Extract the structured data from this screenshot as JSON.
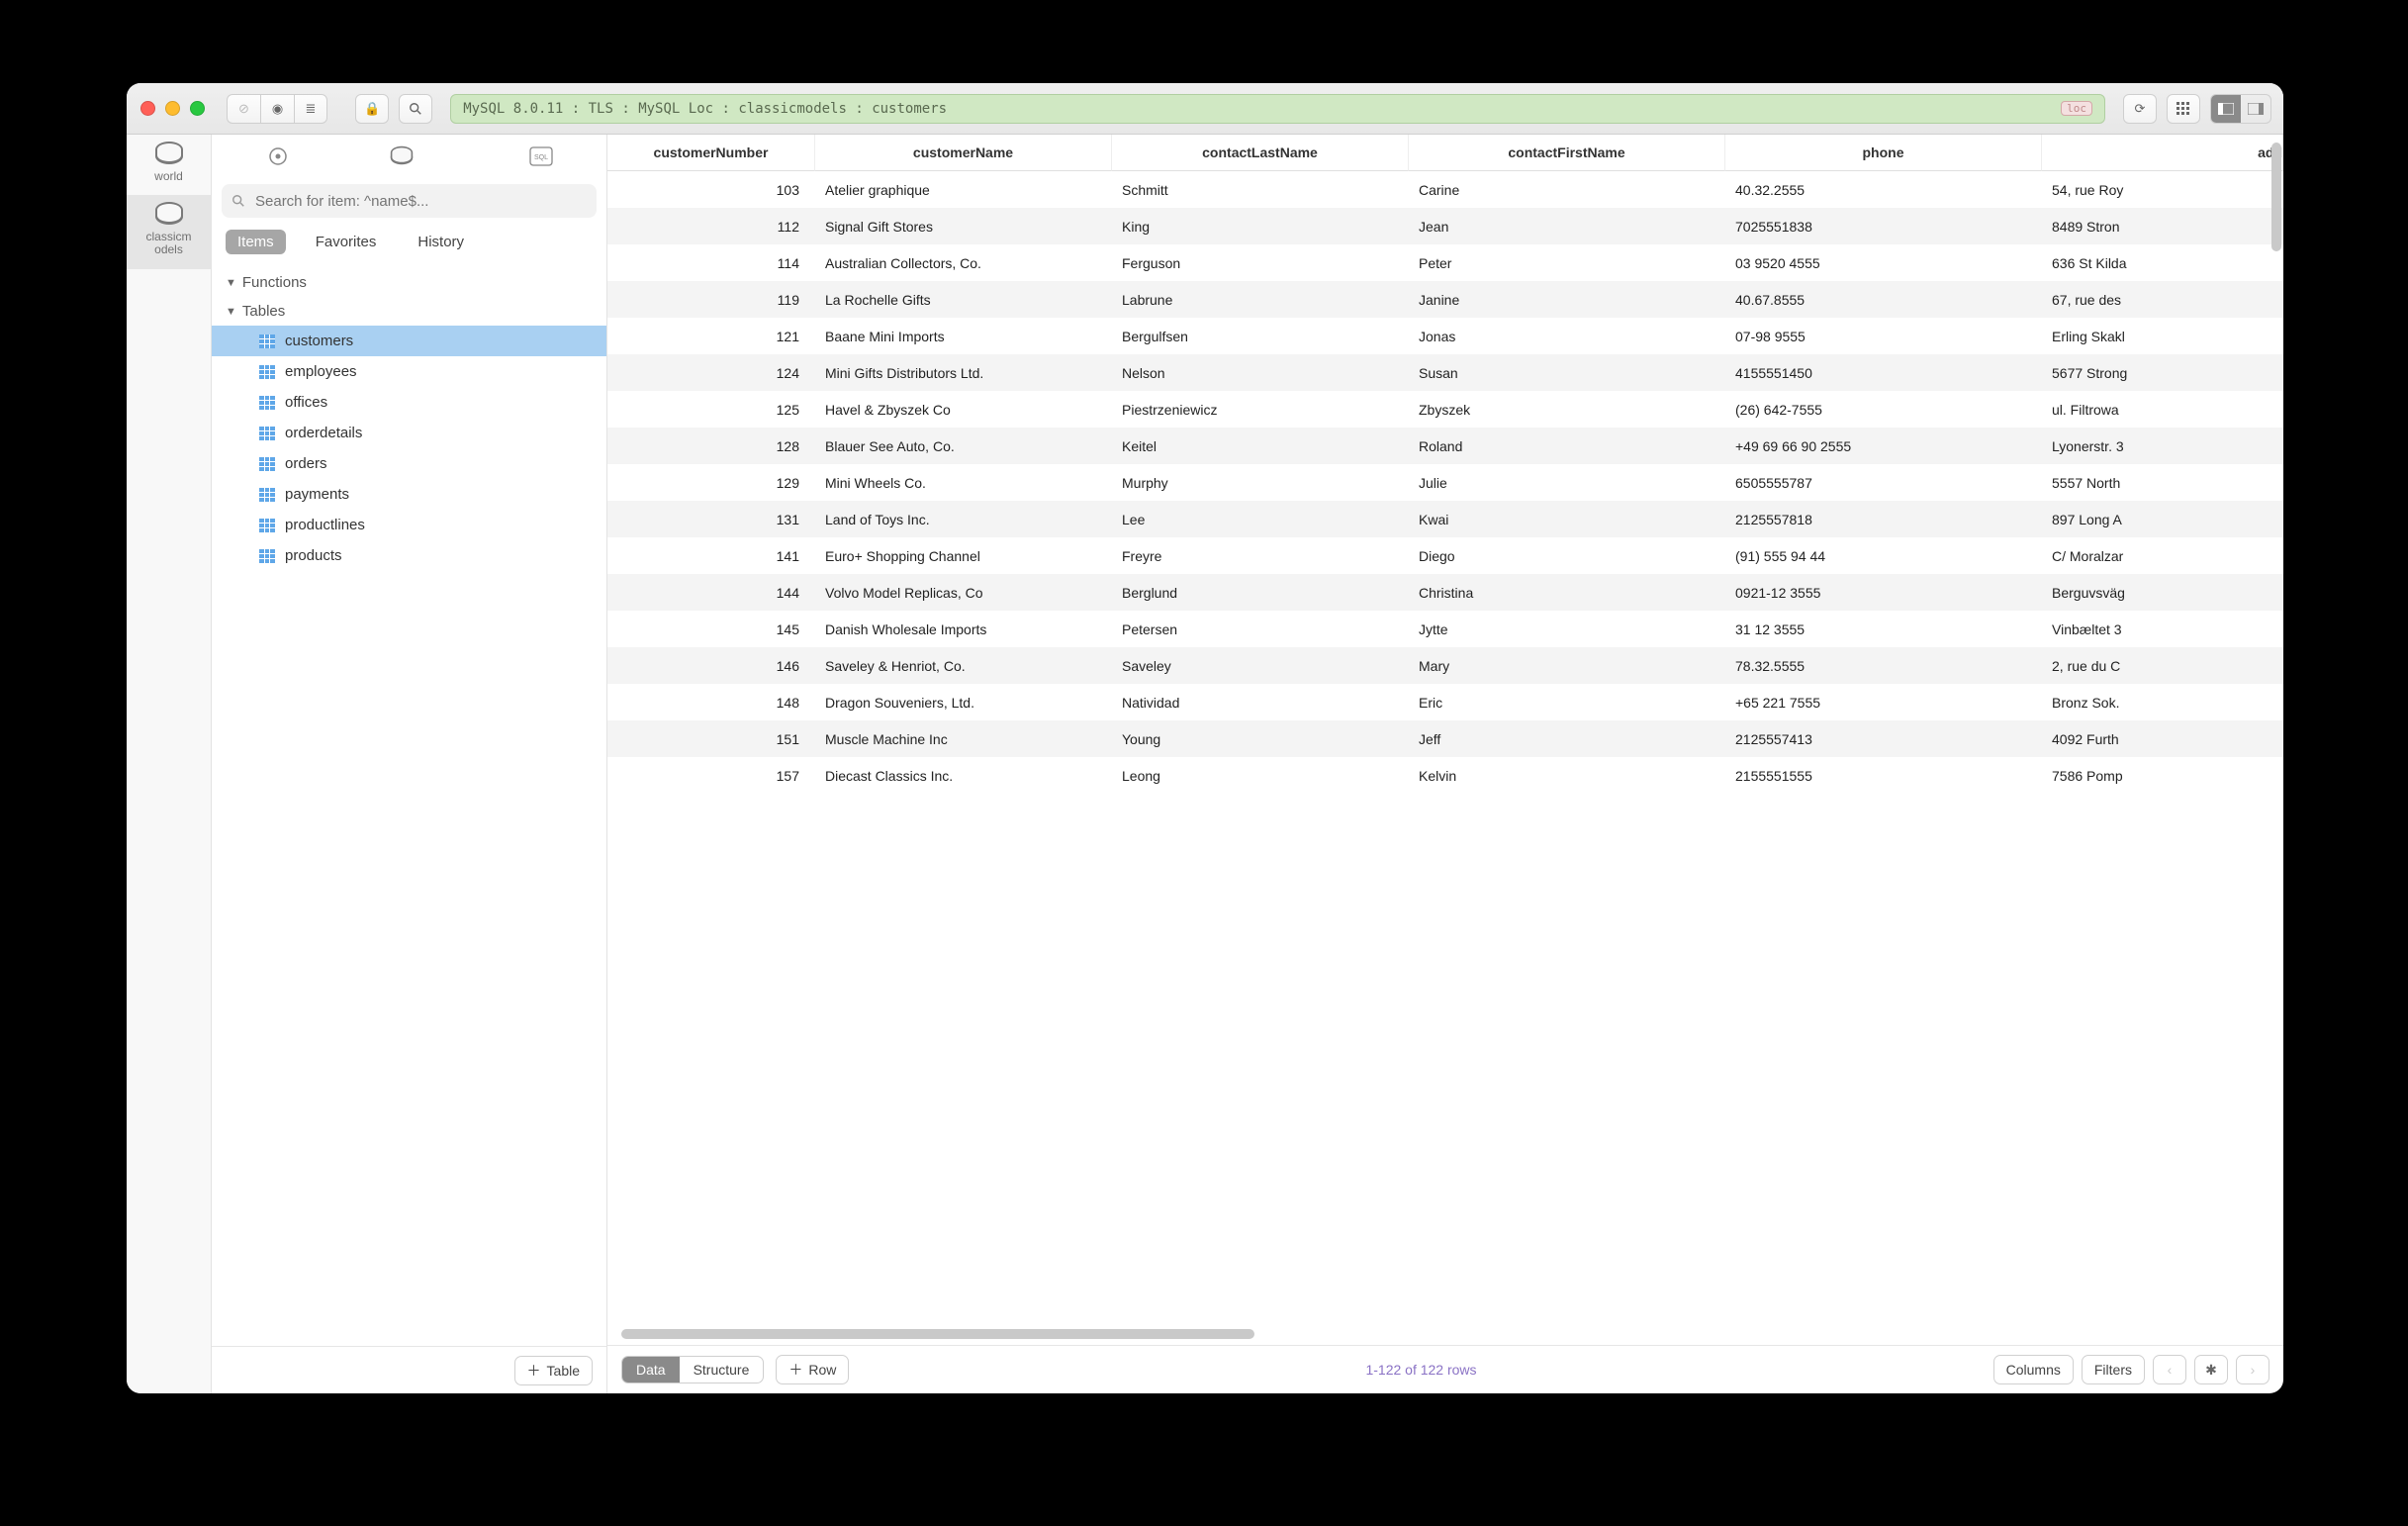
{
  "breadcrumb": "MySQL 8.0.11 : TLS : MySQL Loc : classicmodels : customers",
  "breadcrumb_badge": "loc",
  "db_rail": {
    "items": [
      {
        "label": "world",
        "selected": false
      },
      {
        "label": "classicm\nodels",
        "selected": true
      }
    ]
  },
  "sidebar": {
    "search_placeholder": "Search for item: ^name$...",
    "tabs": {
      "items": "Items",
      "favorites": "Favorites",
      "history": "History"
    },
    "groups": {
      "functions": "Functions",
      "tables": "Tables"
    },
    "tables": [
      "customers",
      "employees",
      "offices",
      "orderdetails",
      "orders",
      "payments",
      "productlines",
      "products"
    ],
    "selected_table_index": 0,
    "add_table_label": "Table"
  },
  "columns": {
    "c0": "customerNumber",
    "c1": "customerName",
    "c2": "contactLastName",
    "c3": "contactFirstName",
    "c4": "phone",
    "c5": "add"
  },
  "rows": [
    {
      "n": "103",
      "name": "Atelier graphique",
      "last": "Schmitt",
      "first": "Carine",
      "phone": "40.32.2555",
      "addr": "54, rue Roy"
    },
    {
      "n": "112",
      "name": "Signal Gift Stores",
      "last": "King",
      "first": "Jean",
      "phone": "7025551838",
      "addr": "8489 Stron"
    },
    {
      "n": "114",
      "name": "Australian Collectors, Co.",
      "last": "Ferguson",
      "first": "Peter",
      "phone": "03 9520 4555",
      "addr": "636 St Kilda"
    },
    {
      "n": "119",
      "name": "La Rochelle Gifts",
      "last": "Labrune",
      "first": "Janine",
      "phone": "40.67.8555",
      "addr": "67, rue des"
    },
    {
      "n": "121",
      "name": "Baane Mini Imports",
      "last": "Bergulfsen",
      "first": "Jonas",
      "phone": "07-98 9555",
      "addr": "Erling Skakl"
    },
    {
      "n": "124",
      "name": "Mini Gifts Distributors Ltd.",
      "last": "Nelson",
      "first": "Susan",
      "phone": "4155551450",
      "addr": "5677 Strong"
    },
    {
      "n": "125",
      "name": "Havel & Zbyszek Co",
      "last": "Piestrzeniewicz",
      "first": "Zbyszek",
      "phone": "(26) 642-7555",
      "addr": "ul. Filtrowa"
    },
    {
      "n": "128",
      "name": "Blauer See Auto, Co.",
      "last": "Keitel",
      "first": "Roland",
      "phone": "+49 69 66 90 2555",
      "addr": "Lyonerstr. 3"
    },
    {
      "n": "129",
      "name": "Mini Wheels Co.",
      "last": "Murphy",
      "first": "Julie",
      "phone": "6505555787",
      "addr": "5557 North"
    },
    {
      "n": "131",
      "name": "Land of Toys Inc.",
      "last": "Lee",
      "first": "Kwai",
      "phone": "2125557818",
      "addr": "897 Long A"
    },
    {
      "n": "141",
      "name": "Euro+ Shopping Channel",
      "last": "Freyre",
      "first": "Diego",
      "phone": "(91) 555 94 44",
      "addr": "C/ Moralzar"
    },
    {
      "n": "144",
      "name": "Volvo Model Replicas, Co",
      "last": "Berglund",
      "first": "Christina",
      "phone": "0921-12 3555",
      "addr": "Berguvsväg"
    },
    {
      "n": "145",
      "name": "Danish Wholesale Imports",
      "last": "Petersen",
      "first": "Jytte",
      "phone": "31 12 3555",
      "addr": "Vinbæltet 3"
    },
    {
      "n": "146",
      "name": "Saveley & Henriot, Co.",
      "last": "Saveley",
      "first": "Mary",
      "phone": "78.32.5555",
      "addr": "2, rue du C"
    },
    {
      "n": "148",
      "name": "Dragon Souveniers, Ltd.",
      "last": "Natividad",
      "first": "Eric",
      "phone": "+65 221 7555",
      "addr": "Bronz Sok."
    },
    {
      "n": "151",
      "name": "Muscle Machine Inc",
      "last": "Young",
      "first": "Jeff",
      "phone": "2125557413",
      "addr": "4092 Furth"
    },
    {
      "n": "157",
      "name": "Diecast Classics Inc.",
      "last": "Leong",
      "first": "Kelvin",
      "phone": "2155551555",
      "addr": "7586 Pomp"
    }
  ],
  "footer": {
    "data": "Data",
    "structure": "Structure",
    "row": "Row",
    "status": "1-122 of 122 rows",
    "columns": "Columns",
    "filters": "Filters"
  }
}
